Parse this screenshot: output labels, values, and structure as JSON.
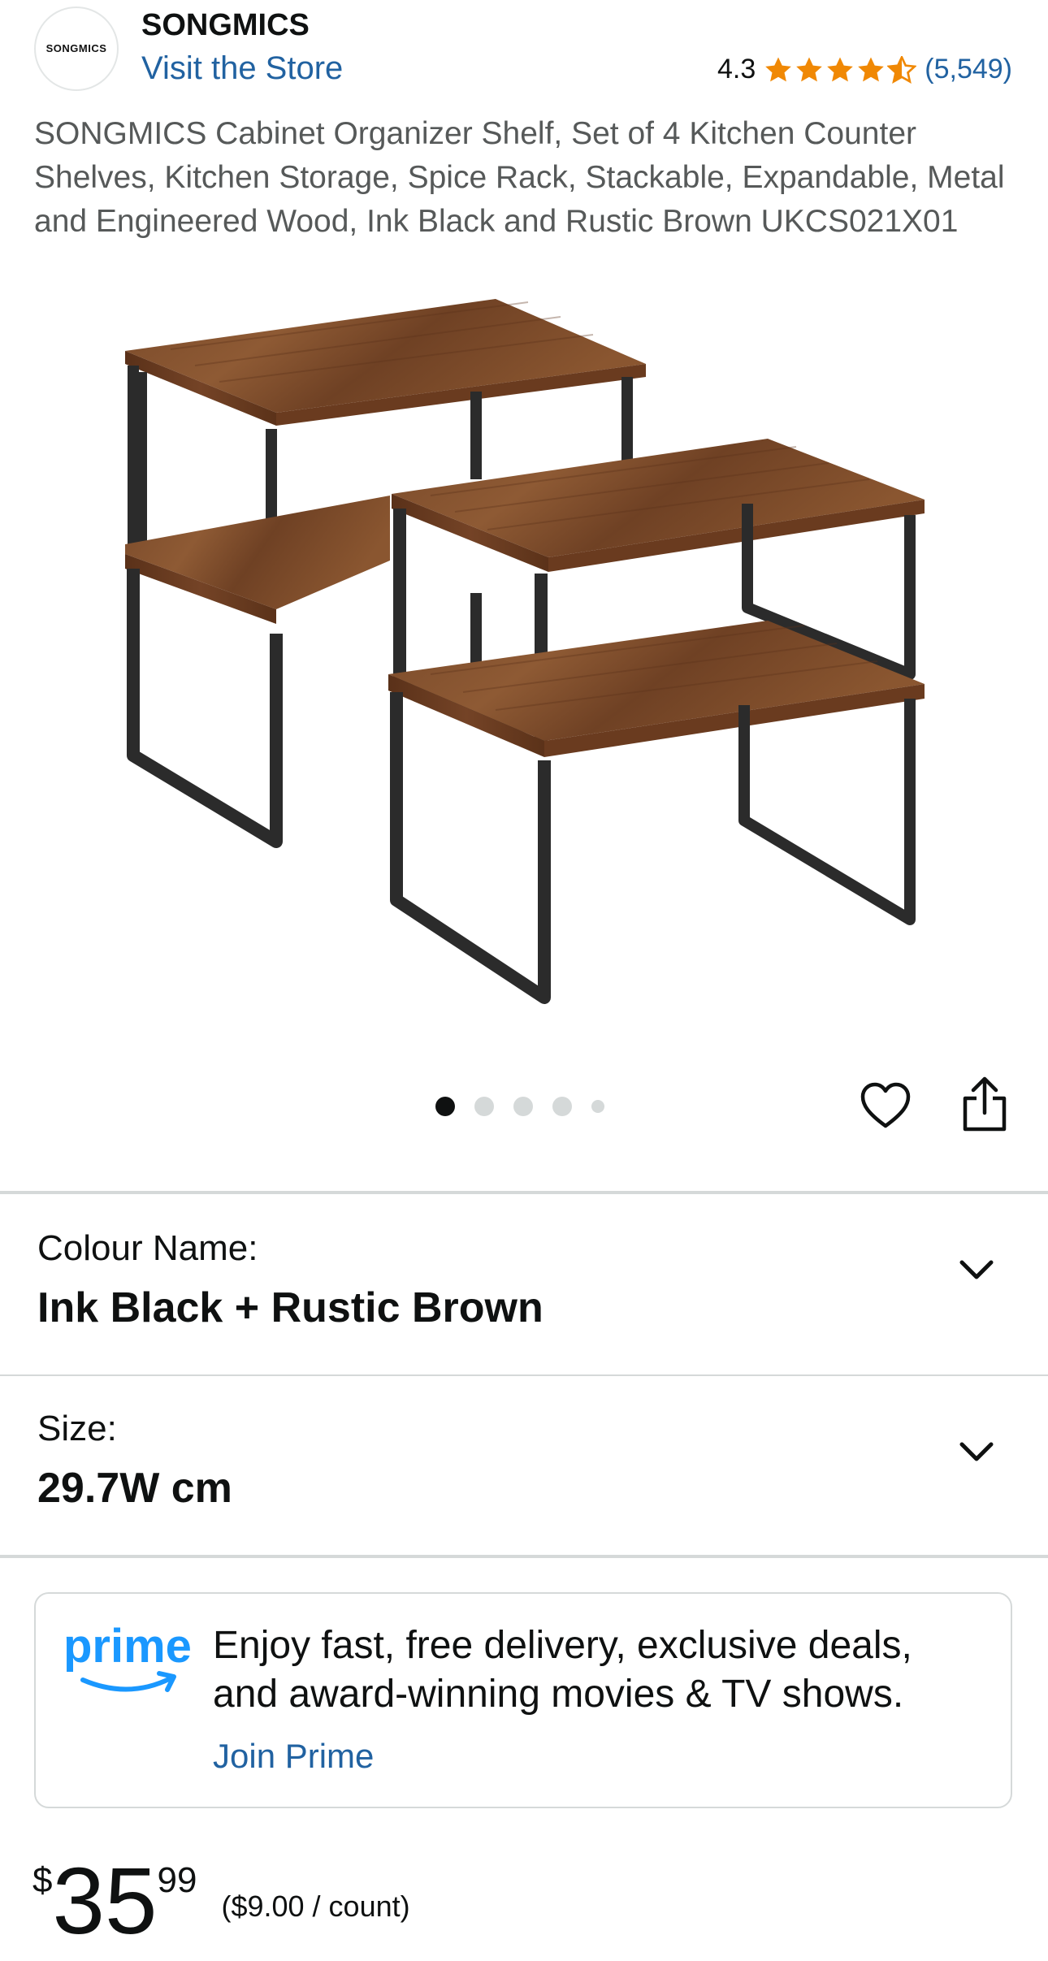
{
  "header": {
    "logo_text": "SONGMICS",
    "brand": "SONGMICS",
    "visit_store": "Visit the Store",
    "rating": "4.3",
    "rating_value": 4.3,
    "rating_count": "(5,549)",
    "star_color": "#f08804"
  },
  "product": {
    "title": "SONGMICS Cabinet Organizer Shelf, Set of 4 Kitchen Counter Shelves, Kitchen Storage, Spice Rack, Stackable, Expandable, Metal and Engineered Wood, Ink Black and Rustic Brown UKCS021X01"
  },
  "carousel": {
    "image_count": 5,
    "active_index": 0
  },
  "options": {
    "colour": {
      "label": "Colour Name:",
      "value": "Ink Black + Rustic Brown"
    },
    "size": {
      "label": "Size:",
      "value": "29.7W cm"
    }
  },
  "prime": {
    "logo_text": "prime",
    "message": "Enjoy fast, free delivery, exclusive deals, and award-winning movies & TV shows.",
    "join_label": "Join Prime",
    "brand_color": "#1a98ff"
  },
  "price": {
    "currency": "$",
    "whole": "35",
    "fraction": "99",
    "per_unit": "($9.00 / count)"
  },
  "colors": {
    "link": "#2162a1",
    "text": "#0f1111",
    "muted": "#565959"
  }
}
